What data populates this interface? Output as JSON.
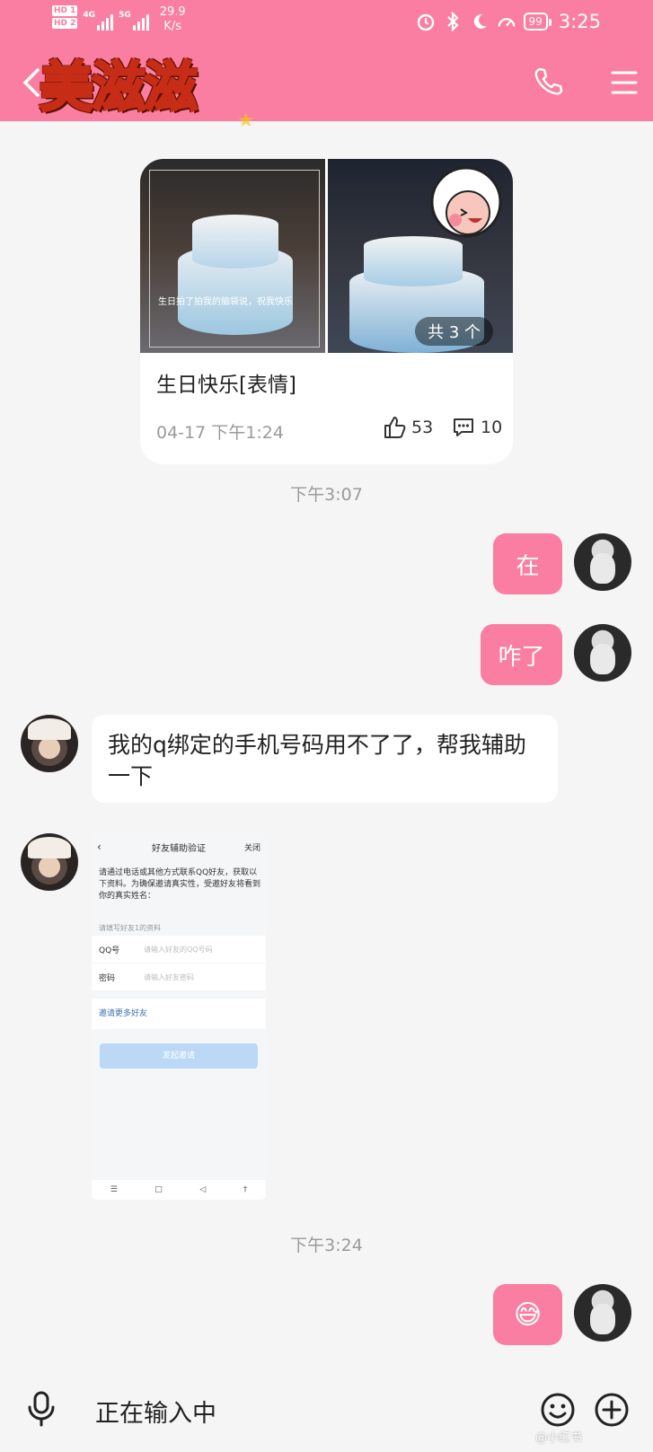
{
  "status_bar": {
    "hd1": "HD 1",
    "hd2": "HD 2",
    "net1": "4G",
    "net2": "5G",
    "speed_value": "29.9",
    "speed_unit": "K/s",
    "battery": "99",
    "time": "3:25"
  },
  "header": {
    "logo_text": "美滋滋"
  },
  "faded_line": {
    "icon": "star-icon"
  },
  "post_card": {
    "image_count": "共 3 个",
    "cake_caption": "生日拍了拍我的脑袋说，祝我快乐",
    "title": "生日快乐[表情]",
    "date": "04-17 下午1:24",
    "likes": "53",
    "comments": "10"
  },
  "messages": {
    "time1": "下午3:07",
    "me_1": "在",
    "me_2": "咋了",
    "other_1": "我的q绑定的手机号码用不了了，帮我辅助一下",
    "time2": "下午3:24",
    "me_3": "😅"
  },
  "screenshot": {
    "title": "好友辅助验证",
    "close": "关闭",
    "desc": "请通过电话或其他方式联系QQ好友，获取以下资料。为确保邀请真实性，受邀好友将看到你的真实姓名：",
    "hint": "请填写好友1的资料",
    "qq_label": "QQ号",
    "qq_placeholder": "请输入好友的QQ号码",
    "pwd_label": "密码",
    "pwd_placeholder": "请输入好友密码",
    "more": "邀请更多好友",
    "button": "发起邀请"
  },
  "input_bar": {
    "text": "正在输入中"
  },
  "watermark": "@小红书"
}
